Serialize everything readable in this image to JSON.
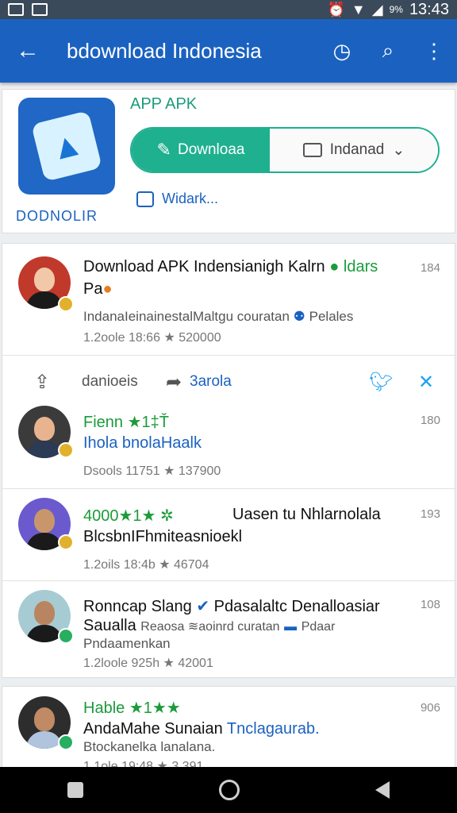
{
  "status_bar": {
    "battery": "9%",
    "time": "13:43"
  },
  "app_bar": {
    "title": "bdownload Indonesia",
    "back_icon": "arrow-left-icon",
    "icons": [
      "clock-icon",
      "search-icon",
      "more-vert-icon"
    ]
  },
  "app_card": {
    "logo_label": "DODNOLIR",
    "type_label": "APP APK",
    "download_label": "Downloaa",
    "language_label": "Indanad",
    "widget_label": "Widark..."
  },
  "reviews": [
    {
      "title": "Download APK Indensianigh Kalrn",
      "tag": "ldars",
      "line2": "Pa",
      "sub": "IndanaIeinainestalMaltgu couratan",
      "sub_tag": "Pelales",
      "meta": "1.2oole 18:66",
      "rating": "520000",
      "num": "184"
    },
    {
      "title": "Fienn ★1‡Ť",
      "line2": "Ihola bnolaHaalk",
      "meta": "Dsools 11751",
      "rating": "137900",
      "num": "180"
    },
    {
      "title": "4000★1★",
      "title_right": "Uasen tu Nhlarnolala",
      "line2": "BlcsbnIFhmiteasnioekl",
      "meta": "1.2oils 18:4b",
      "rating": "46704",
      "num": "193"
    },
    {
      "title": "Ronncap Slang",
      "title_right": "Pdasalaltc Denalloasiar",
      "line2": "Saualla",
      "line2_sub": "Reaosa ≋aoinrd curatan",
      "line2_tag": "Pdaar",
      "sub": "Pndaamenkan",
      "meta": "1.2loole 925h",
      "rating": "42001",
      "num": "108"
    },
    {
      "title": "Hable ★1★★",
      "line2": "AndaMahe Sunaian",
      "line2_tag": "Tnclagaurab.",
      "sub": "Btockanelka lanalana.",
      "meta": "1 1ole 19:48",
      "rating": "3.391",
      "num": "906"
    }
  ],
  "actions": {
    "label1": "danioeis",
    "label2": "3arola"
  },
  "colors": {
    "primary": "#1b62c0",
    "accent": "#1fb08f",
    "green": "#1c9b3a"
  }
}
